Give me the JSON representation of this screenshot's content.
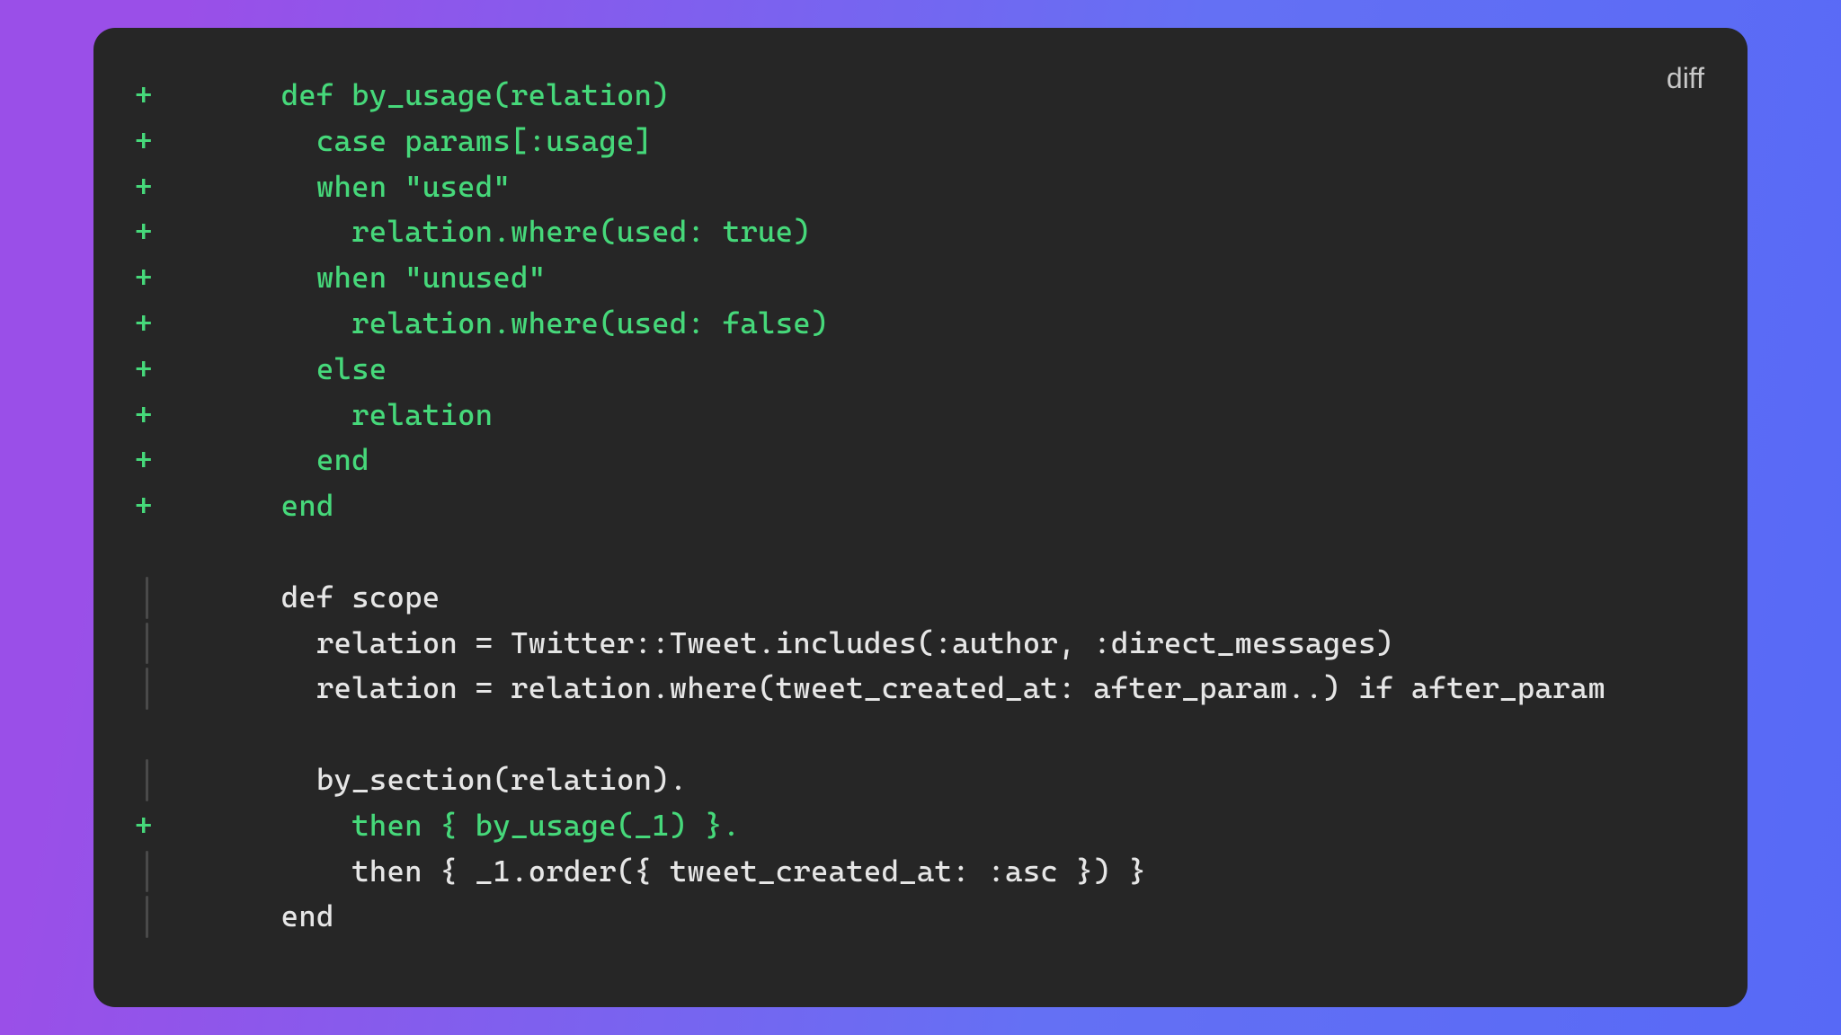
{
  "language_label": "diff",
  "lines": [
    {
      "type": "added",
      "marker": "+",
      "text": "    def by_usage(relation)"
    },
    {
      "type": "added",
      "marker": "+",
      "text": "      case params[:usage]"
    },
    {
      "type": "added",
      "marker": "+",
      "text": "      when \"used\""
    },
    {
      "type": "added",
      "marker": "+",
      "text": "        relation.where(used: true)"
    },
    {
      "type": "added",
      "marker": "+",
      "text": "      when \"unused\""
    },
    {
      "type": "added",
      "marker": "+",
      "text": "        relation.where(used: false)"
    },
    {
      "type": "added",
      "marker": "+",
      "text": "      else"
    },
    {
      "type": "added",
      "marker": "+",
      "text": "        relation"
    },
    {
      "type": "added",
      "marker": "+",
      "text": "      end"
    },
    {
      "type": "added",
      "marker": "+",
      "text": "    end"
    },
    {
      "type": "blank",
      "marker": "",
      "text": ""
    },
    {
      "type": "context",
      "marker": "",
      "text": "    def scope"
    },
    {
      "type": "context",
      "marker": "",
      "text": "      relation = Twitter::Tweet.includes(:author, :direct_messages)"
    },
    {
      "type": "context",
      "marker": "",
      "text": "      relation = relation.where(tweet_created_at: after_param..) if after_param"
    },
    {
      "type": "blank",
      "marker": "",
      "text": ""
    },
    {
      "type": "context",
      "marker": "",
      "text": "      by_section(relation)."
    },
    {
      "type": "added",
      "marker": "+",
      "text": "        then { by_usage(_1) }."
    },
    {
      "type": "context",
      "marker": "",
      "text": "        then { _1.order({ tweet_created_at: :asc }) }"
    },
    {
      "type": "context",
      "marker": "",
      "text": "    end"
    }
  ]
}
